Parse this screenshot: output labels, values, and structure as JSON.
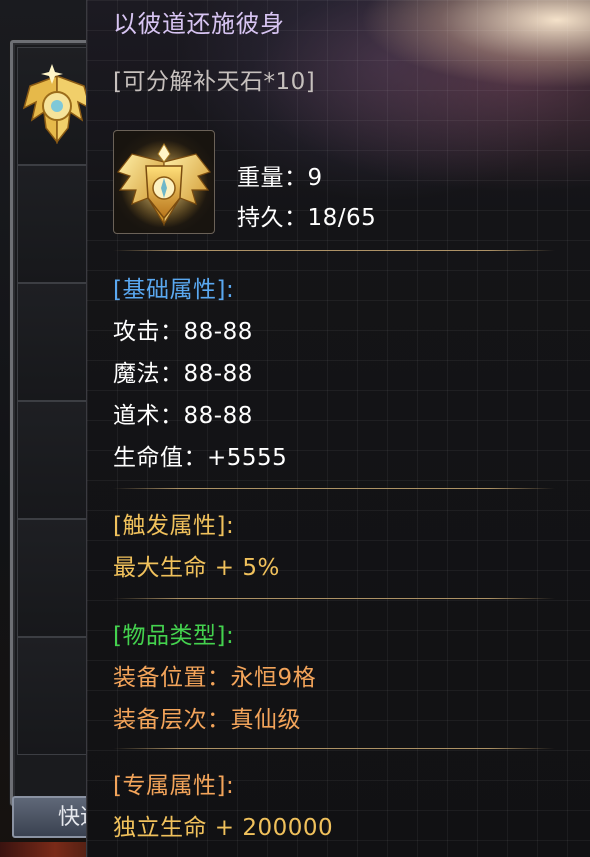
{
  "inventory": {
    "quick_button_label": "快速"
  },
  "tooltip": {
    "name": "以彼道还施彼身",
    "decompose": "[可分解补天石*10]",
    "weight_label": "重量：",
    "weight_value": "9",
    "durability_label": "持久：",
    "durability_value": "18/65",
    "sections": {
      "base": {
        "header": "[基础属性]:",
        "lines": [
          {
            "label": "攻击：",
            "value": "88-88"
          },
          {
            "label": "魔法：",
            "value": "88-88"
          },
          {
            "label": "道术：",
            "value": "88-88"
          },
          {
            "label": "生命值：",
            "value": "+5555"
          }
        ]
      },
      "trigger": {
        "header": "[触发属性]:",
        "lines": [
          "最大生命 + 5%"
        ]
      },
      "item_type": {
        "header": "[物品类型]:",
        "lines": [
          "装备位置：永恒9格",
          "装备层次：真仙级"
        ]
      },
      "exclusive": {
        "header": "[专属属性]:",
        "lines": [
          "独立生命 + 200000"
        ]
      }
    },
    "icon": "golden-winged-shield-icon"
  },
  "colors": {
    "title": "#d7c4f2",
    "section_base": "#5aa8f0",
    "section_trigger": "#f0c15c",
    "section_item_type": "#44d24e",
    "section_exclusive": "#f3a45a"
  }
}
